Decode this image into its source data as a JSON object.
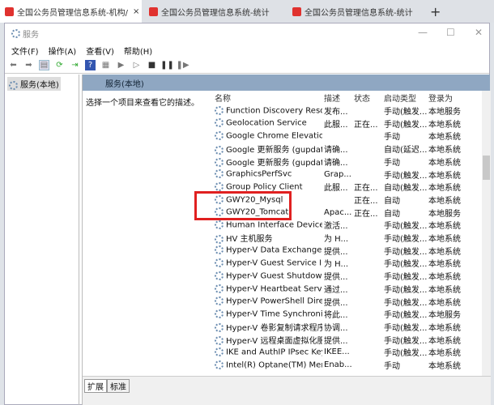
{
  "browser_tabs": [
    {
      "label": "全国公务员管理信息系统-机构/"
    },
    {
      "label": "全国公务员管理信息系统-统计"
    },
    {
      "label": "全国公务员管理信息系统-统计"
    }
  ],
  "new_tab": "+",
  "close_tab": "×",
  "window": {
    "title": "服务",
    "minimize": "—",
    "maximize": "☐",
    "close": "✕"
  },
  "menu": [
    "文件(F)",
    "操作(A)",
    "查看(V)",
    "帮助(H)"
  ],
  "tree": {
    "item": "服务(本地)"
  },
  "panel": {
    "header": "服务(本地)",
    "description": "选择一个项目来查看它的描述。"
  },
  "columns": [
    "名称",
    "描述",
    "状态",
    "启动类型",
    "登录为"
  ],
  "services": [
    [
      "Function Discovery Resour...",
      "发布...",
      "",
      "手动(触发...",
      "本地服务"
    ],
    [
      "Geolocation Service",
      "此服...",
      "正在...",
      "手动(触发...",
      "本地系统"
    ],
    [
      "Google Chrome Elevation ...",
      "",
      "",
      "手动",
      "本地系统"
    ],
    [
      "Google 更新服务 (gupdate)",
      "请确...",
      "",
      "自动(延迟...",
      "本地系统"
    ],
    [
      "Google 更新服务 (gupdate...",
      "请确...",
      "",
      "手动",
      "本地系统"
    ],
    [
      "GraphicsPerfSvc",
      "Grap...",
      "",
      "手动(触发...",
      "本地系统"
    ],
    [
      "Group Policy Client",
      "此服...",
      "正在...",
      "自动(触发...",
      "本地系统"
    ],
    [
      "GWY20_Mysql",
      "",
      "正在...",
      "自动",
      "本地系统"
    ],
    [
      "GWY20_Tomcat",
      "Apac...",
      "正在...",
      "自动",
      "本地服务"
    ],
    [
      "Human Interface Device S...",
      "激活...",
      "",
      "手动(触发...",
      "本地系统"
    ],
    [
      "HV 主机服务",
      "为 H...",
      "",
      "手动(触发...",
      "本地系统"
    ],
    [
      "Hyper-V Data Exchange Se...",
      "提供...",
      "",
      "手动(触发...",
      "本地系统"
    ],
    [
      "Hyper-V Guest Service Int...",
      "为 H...",
      "",
      "手动(触发...",
      "本地系统"
    ],
    [
      "Hyper-V Guest Shutdown ...",
      "提供...",
      "",
      "手动(触发...",
      "本地系统"
    ],
    [
      "Hyper-V Heartbeat Service",
      "通过...",
      "",
      "手动(触发...",
      "本地系统"
    ],
    [
      "Hyper-V PowerShell Direct...",
      "提供...",
      "",
      "手动(触发...",
      "本地系统"
    ],
    [
      "Hyper-V Time Synchroniza...",
      "将此...",
      "",
      "手动(触发...",
      "本地服务"
    ],
    [
      "Hyper-V 卷影复制请求程序",
      "协调...",
      "",
      "手动(触发...",
      "本地系统"
    ],
    [
      "Hyper-V 远程桌面虚拟化服...",
      "提供...",
      "",
      "手动(触发...",
      "本地系统"
    ],
    [
      "IKE and AuthIP IPsec Keyin...",
      "IKEE...",
      "",
      "手动(触发...",
      "本地系统"
    ],
    [
      "Intel(R) Optane(TM) Mem...",
      "Enab...",
      "",
      "手动",
      "本地系统"
    ]
  ],
  "bottom_tabs": [
    "扩展",
    "标准"
  ],
  "highlight_color": "#e02020"
}
